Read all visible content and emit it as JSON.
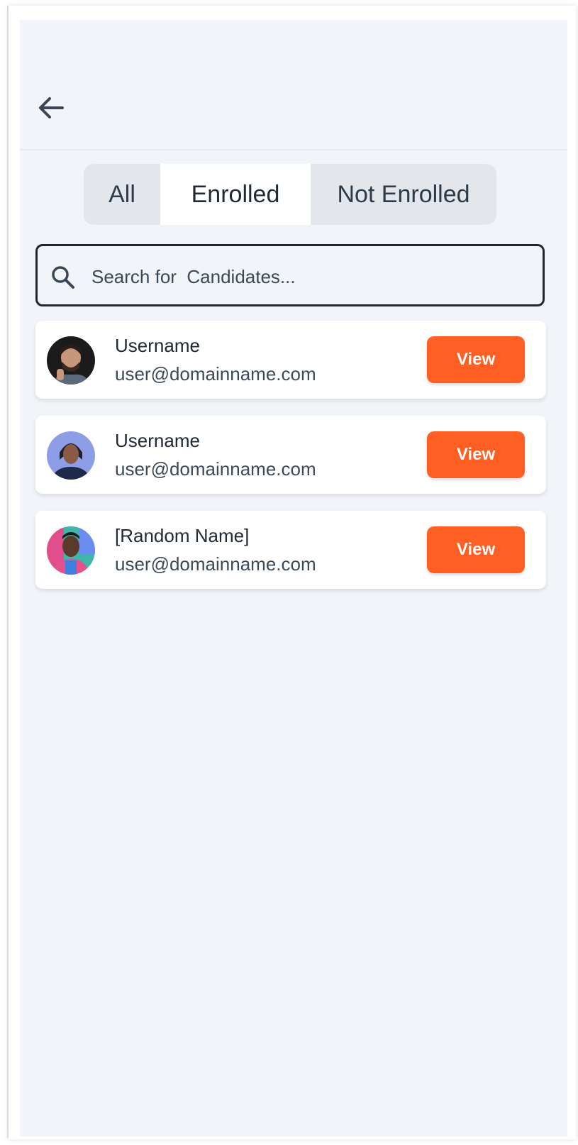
{
  "header": {
    "back_icon": "arrow-left-icon"
  },
  "tabs": [
    {
      "label": "All",
      "active": false
    },
    {
      "label": "Enrolled",
      "active": true
    },
    {
      "label": "Not Enrolled",
      "active": false
    }
  ],
  "search": {
    "placeholder": "Search for  Candidates...",
    "value": "",
    "icon": "search-icon"
  },
  "candidates": [
    {
      "name": "Username",
      "email": "user@domainname.com",
      "button": "View"
    },
    {
      "name": "Username",
      "email": "user@domainname.com",
      "button": "View"
    },
    {
      "name": "[Random Name]",
      "email": "user@domainname.com",
      "button": "View"
    }
  ],
  "colors": {
    "accent": "#ff5f23",
    "background": "#f1f4f9",
    "tab_track": "#e3e7ec"
  }
}
